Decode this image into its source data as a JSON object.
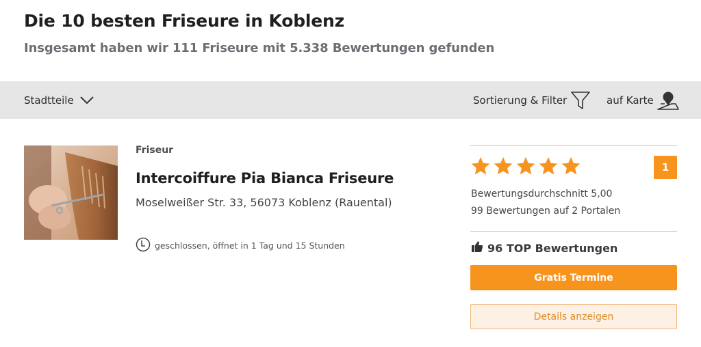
{
  "header": {
    "title": "Die 10 besten Friseure in Koblenz",
    "subtitle": "Insgesamt haben wir 111 Friseure mit 5.338 Bewertungen gefunden"
  },
  "toolbar": {
    "districts_label": "Stadtteile",
    "filter_label": "Sortierung & Filter",
    "map_label": "auf Karte"
  },
  "listing": {
    "category": "Friseur",
    "name": "Intercoiffure Pia Bianca Friseure",
    "address": "Moselweißer Str. 33, 56073 Koblenz (Rauental)",
    "opening_status": "geschlossen, öffnet in 1 Tag und 15 Stunden",
    "rating": {
      "stars": 5,
      "average_text": "Bewertungsdurchschnitt 5,00",
      "count_text": "99 Bewertungen auf 2 Portalen",
      "rank": "1"
    },
    "top_reviews": "96 TOP Bewertungen",
    "primary_button": "Gratis Termine",
    "secondary_button": "Details anzeigen"
  },
  "colors": {
    "accent": "#f7941d",
    "toolbar_bg": "#e6e6e6",
    "secondary_bg": "#fdf0e4"
  }
}
